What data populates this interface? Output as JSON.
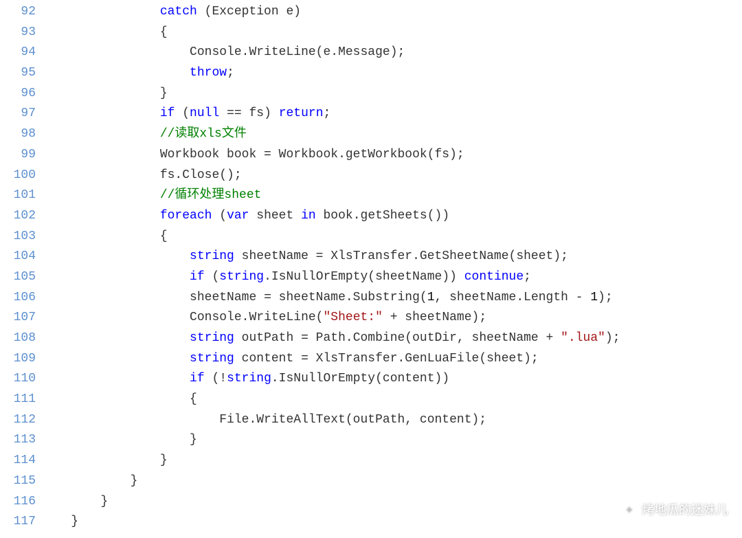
{
  "startLine": 92,
  "watermark": "烤地瓜的迷妹儿",
  "lines": [
    [
      {
        "i": 16
      },
      {
        "t": "catch",
        "c": "kw"
      },
      {
        "t": " (Exception e)"
      }
    ],
    [
      {
        "i": 16
      },
      {
        "t": "{"
      }
    ],
    [
      {
        "i": 20
      },
      {
        "t": "Console.WriteLine(e.Message);"
      }
    ],
    [
      {
        "i": 20
      },
      {
        "t": "throw",
        "c": "kw"
      },
      {
        "t": ";"
      }
    ],
    [
      {
        "i": 16
      },
      {
        "t": "}"
      }
    ],
    [
      {
        "i": 16
      },
      {
        "t": "if",
        "c": "kw"
      },
      {
        "t": " ("
      },
      {
        "t": "null",
        "c": "kw"
      },
      {
        "t": " == fs) "
      },
      {
        "t": "return",
        "c": "kw"
      },
      {
        "t": ";"
      }
    ],
    [
      {
        "i": 16
      },
      {
        "t": "//读取xls文件",
        "c": "com"
      }
    ],
    [
      {
        "i": 16
      },
      {
        "t": "Workbook book = Workbook.getWorkbook(fs);"
      }
    ],
    [
      {
        "i": 16
      },
      {
        "t": "fs.Close();"
      }
    ],
    [
      {
        "i": 16
      },
      {
        "t": "//循环处理sheet",
        "c": "com"
      }
    ],
    [
      {
        "i": 16
      },
      {
        "t": "foreach",
        "c": "kw"
      },
      {
        "t": " ("
      },
      {
        "t": "var",
        "c": "kw"
      },
      {
        "t": " sheet "
      },
      {
        "t": "in",
        "c": "kw"
      },
      {
        "t": " book.getSheets())"
      }
    ],
    [
      {
        "i": 16
      },
      {
        "t": "{"
      }
    ],
    [
      {
        "i": 20
      },
      {
        "t": "string",
        "c": "kw"
      },
      {
        "t": " sheetName = XlsTransfer.GetSheetName(sheet);"
      }
    ],
    [
      {
        "i": 20
      },
      {
        "t": "if",
        "c": "kw"
      },
      {
        "t": " ("
      },
      {
        "t": "string",
        "c": "kw"
      },
      {
        "t": ".IsNullOrEmpty(sheetName)) "
      },
      {
        "t": "continue",
        "c": "kw"
      },
      {
        "t": ";"
      }
    ],
    [
      {
        "i": 20
      },
      {
        "t": "sheetName = sheetName.Substring("
      },
      {
        "t": "1",
        "c": "num"
      },
      {
        "t": ", sheetName.Length - "
      },
      {
        "t": "1",
        "c": "num"
      },
      {
        "t": ");"
      }
    ],
    [
      {
        "i": 20
      },
      {
        "t": "Console.WriteLine("
      },
      {
        "t": "\"Sheet:\"",
        "c": "str"
      },
      {
        "t": " + sheetName);"
      }
    ],
    [
      {
        "i": 20
      },
      {
        "t": "string",
        "c": "kw"
      },
      {
        "t": " outPath = Path.Combine(outDir, sheetName + "
      },
      {
        "t": "\".lua\"",
        "c": "str"
      },
      {
        "t": ");"
      }
    ],
    [
      {
        "i": 20
      },
      {
        "t": "string",
        "c": "kw"
      },
      {
        "t": " content = XlsTransfer.GenLuaFile(sheet);"
      }
    ],
    [
      {
        "i": 20
      },
      {
        "t": "if",
        "c": "kw"
      },
      {
        "t": " (!"
      },
      {
        "t": "string",
        "c": "kw"
      },
      {
        "t": ".IsNullOrEmpty(content))"
      }
    ],
    [
      {
        "i": 20
      },
      {
        "t": "{"
      }
    ],
    [
      {
        "i": 24
      },
      {
        "t": "File.WriteAllText(outPath, content);"
      }
    ],
    [
      {
        "i": 20
      },
      {
        "t": "}"
      }
    ],
    [
      {
        "i": 16
      },
      {
        "t": "}"
      }
    ],
    [
      {
        "i": 12
      },
      {
        "t": "}"
      }
    ],
    [
      {
        "i": 8
      },
      {
        "t": "}"
      }
    ],
    [
      {
        "i": 4
      },
      {
        "t": "}"
      }
    ]
  ]
}
